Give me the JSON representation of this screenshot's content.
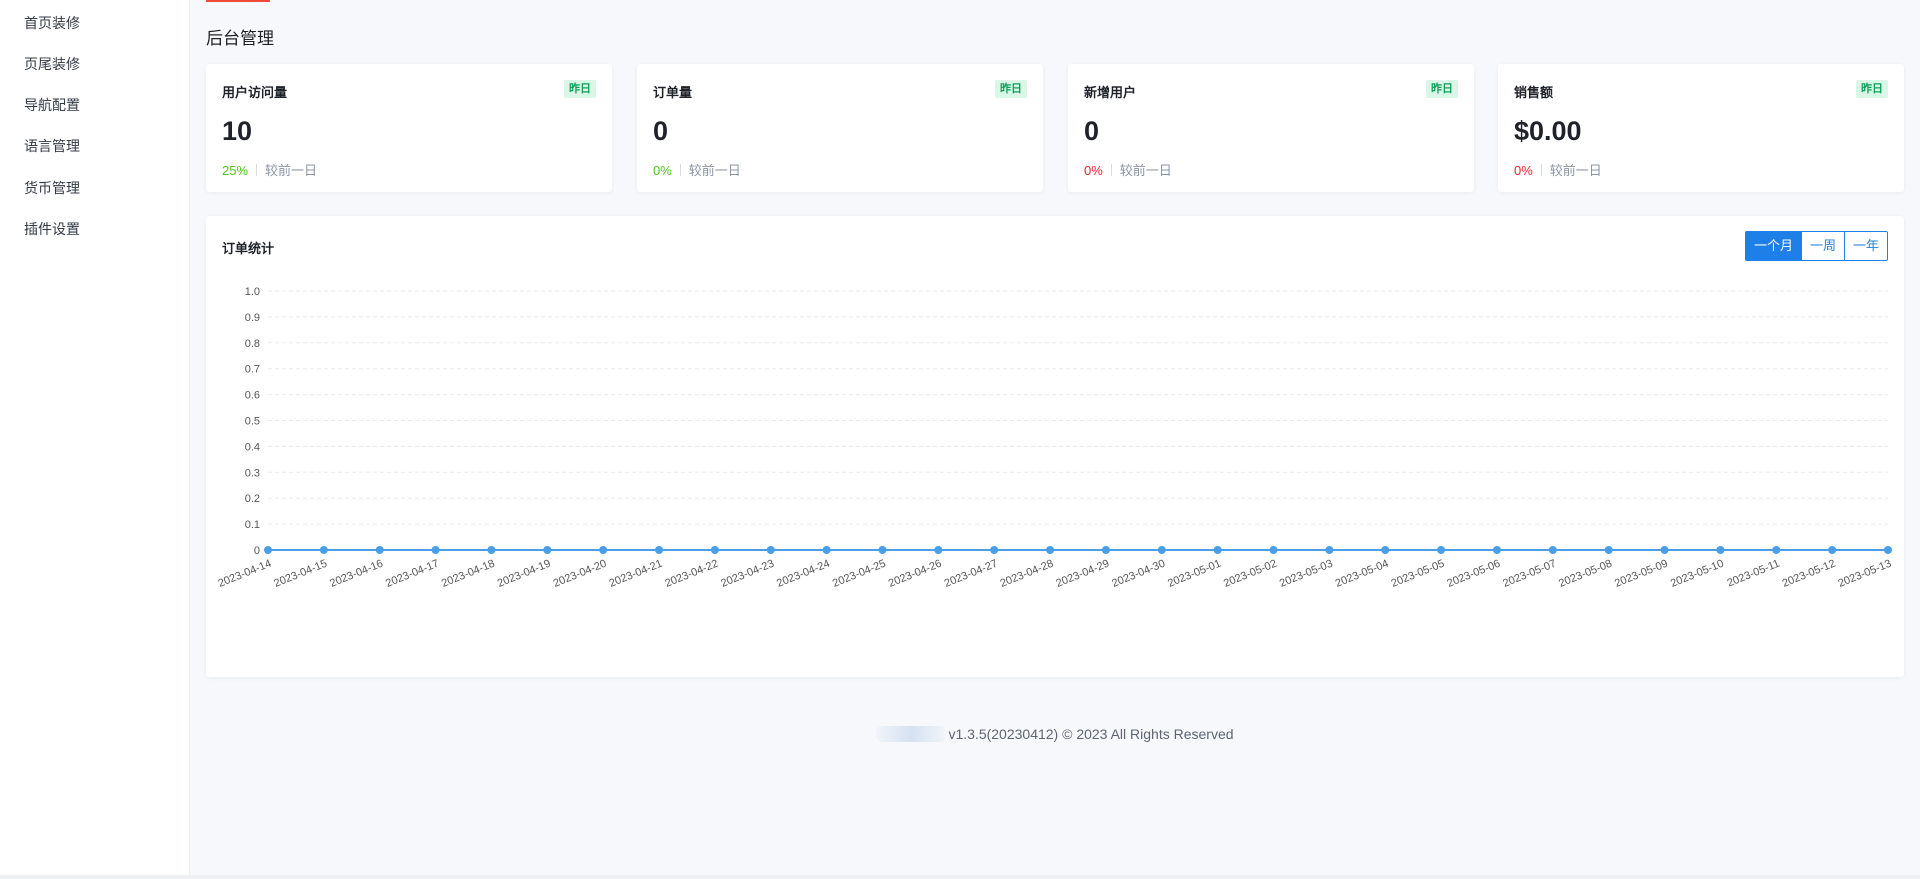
{
  "sidebar": {
    "items": [
      {
        "label": "首页装修"
      },
      {
        "label": "页尾装修"
      },
      {
        "label": "导航配置"
      },
      {
        "label": "语言管理"
      },
      {
        "label": "货币管理"
      },
      {
        "label": "插件设置"
      }
    ]
  },
  "page": {
    "title": "后台管理"
  },
  "cards": [
    {
      "title": "用户访问量",
      "badge": "昨日",
      "value": "10",
      "change": "25%",
      "trend": "up",
      "compare": "较前一日"
    },
    {
      "title": "订单量",
      "badge": "昨日",
      "value": "0",
      "change": "0%",
      "trend": "up",
      "compare": "较前一日"
    },
    {
      "title": "新增用户",
      "badge": "昨日",
      "value": "0",
      "change": "0%",
      "trend": "down",
      "compare": "较前一日"
    },
    {
      "title": "销售额",
      "badge": "昨日",
      "value": "$0.00",
      "change": "0%",
      "trend": "down",
      "compare": "较前一日"
    }
  ],
  "order_chart": {
    "title": "订单统计",
    "ranges": [
      "一个月",
      "一周",
      "一年"
    ],
    "active_range": "一个月"
  },
  "chart_data": {
    "type": "line",
    "title": "",
    "xlabel": "",
    "ylabel": "",
    "x": [
      "2023-04-14",
      "2023-04-15",
      "2023-04-16",
      "2023-04-17",
      "2023-04-18",
      "2023-04-19",
      "2023-04-20",
      "2023-04-21",
      "2023-04-22",
      "2023-04-23",
      "2023-04-24",
      "2023-04-25",
      "2023-04-26",
      "2023-04-27",
      "2023-04-28",
      "2023-04-29",
      "2023-04-30",
      "2023-05-01",
      "2023-05-02",
      "2023-05-03",
      "2023-05-04",
      "2023-05-05",
      "2023-05-06",
      "2023-05-07",
      "2023-05-08",
      "2023-05-09",
      "2023-05-10",
      "2023-05-11",
      "2023-05-12",
      "2023-05-13"
    ],
    "series": [
      {
        "values": [
          0,
          0,
          0,
          0,
          0,
          0,
          0,
          0,
          0,
          0,
          0,
          0,
          0,
          0,
          0,
          0,
          0,
          0,
          0,
          0,
          0,
          0,
          0,
          0,
          0,
          0,
          0,
          0,
          0,
          0
        ]
      }
    ],
    "ylim": [
      0,
      1.0
    ],
    "yticks": [
      "0",
      "0.1",
      "0.2",
      "0.3",
      "0.4",
      "0.5",
      "0.6",
      "0.7",
      "0.8",
      "0.9",
      "1.0"
    ],
    "grid": true,
    "line_color": "#4a9ee8",
    "grid_color": "#e8ebf0"
  },
  "footer": {
    "text": "v1.3.5(20230412) © 2023 All Rights Reserved"
  }
}
